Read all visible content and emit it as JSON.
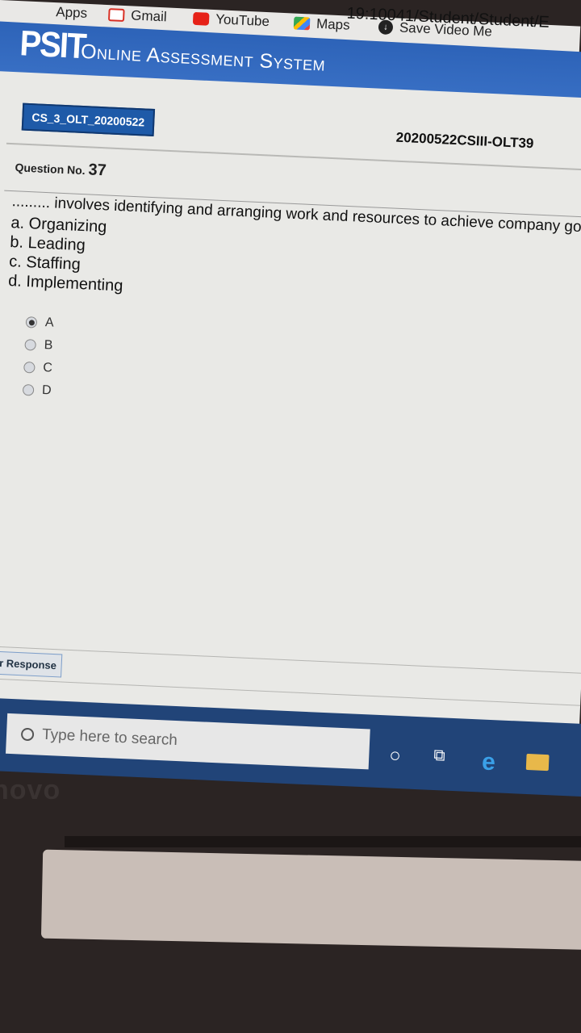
{
  "browser": {
    "url_fragment": "19:10041/Student/Student/E",
    "bookmarks": [
      {
        "label": "Apps",
        "icon": "apps-icon"
      },
      {
        "label": "Gmail",
        "icon": "gmail-icon"
      },
      {
        "label": "YouTube",
        "icon": "youtube-icon"
      },
      {
        "label": "Maps",
        "icon": "maps-icon"
      },
      {
        "label": "Save Video Me",
        "icon": "save-video-icon"
      }
    ]
  },
  "header": {
    "logo": "PSIT",
    "title": "Online Assessment System"
  },
  "exam": {
    "test_code": "CS_3_OLT_20200522",
    "session_id": "20200522CSIII-OLT39",
    "question_label": "Question No.",
    "question_number": "37",
    "question_text": "......... involves identifying and arranging work and resources to achieve company goa",
    "options": [
      "a. Organizing",
      "b. Leading",
      "c. Staffing",
      "d. Implementing"
    ],
    "choices": [
      {
        "label": "A",
        "selected": true
      },
      {
        "label": "B",
        "selected": false
      },
      {
        "label": "C",
        "selected": false
      },
      {
        "label": "D",
        "selected": false
      }
    ],
    "clear_label": "Clear Response"
  },
  "taskbar": {
    "search_placeholder": "Type here to search"
  },
  "laptop": {
    "brand_fragment": "novo"
  },
  "colors": {
    "header_blue": "#2d63b8",
    "taskbar_blue": "#214478",
    "tag_blue": "#1e5aa8"
  }
}
